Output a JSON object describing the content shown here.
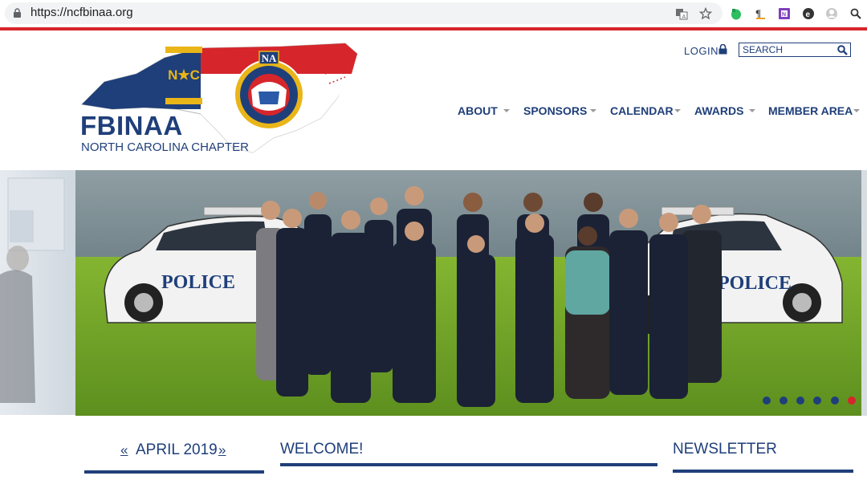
{
  "browser": {
    "url": "https://ncfbinaa.org",
    "icons": [
      "lock-icon",
      "translate-icon",
      "star-icon",
      "evernote-icon",
      "format-icon",
      "onenote-icon",
      "extension-icon",
      "profile-icon",
      "search-icon"
    ]
  },
  "logo": {
    "title": "FBINAA",
    "subtitle": "NORTH CAROLINA CHAPTER",
    "flag_letters": "N★C",
    "seal_text": "NA",
    "colors": {
      "navy": "#1f3f7a",
      "red": "#d6262b",
      "gold": "#e9b518"
    }
  },
  "header": {
    "login_label": "LOGIN",
    "search_placeholder": "SEARCH",
    "nav": [
      {
        "label": "ABOUT"
      },
      {
        "label": "SPONSORS"
      },
      {
        "label": "CALENDAR"
      },
      {
        "label": "AWARDS"
      },
      {
        "label": "MEMBER AREA"
      }
    ]
  },
  "hero": {
    "car_label_left": "POLICE",
    "car_label_right": "POLICE",
    "slide_count": 6,
    "active_slide": 6
  },
  "sections": {
    "calendar": {
      "prev": "«",
      "month": "APRIL 2019",
      "next": "»"
    },
    "welcome": "WELCOME!",
    "newsletter": "NEWSLETTER"
  }
}
